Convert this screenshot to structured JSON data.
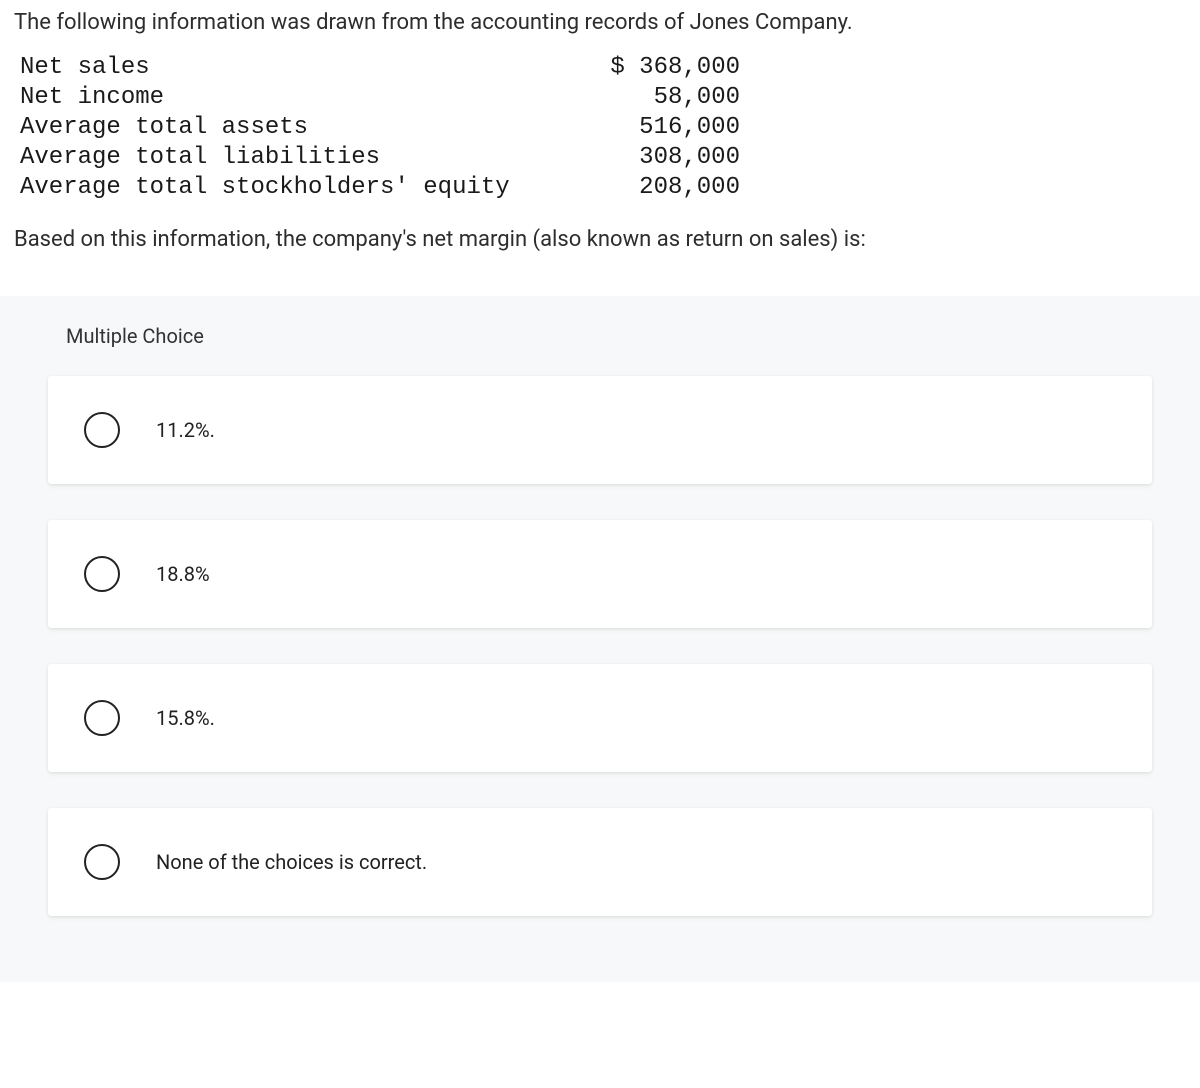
{
  "question": {
    "intro": "The following information was drawn from the accounting records of Jones Company.",
    "followup": "Based on this information, the company's net margin (also known as return on sales) is:"
  },
  "data_rows": [
    {
      "label": "Net sales",
      "value": "$ 368,000"
    },
    {
      "label": "Net income",
      "value": "58,000"
    },
    {
      "label": "Average total assets",
      "value": "516,000"
    },
    {
      "label": "Average total liabilities",
      "value": "308,000"
    },
    {
      "label": "Average total stockholders' equity",
      "value": "208,000"
    }
  ],
  "mc": {
    "heading": "Multiple Choice",
    "choices": [
      {
        "label": "11.2%."
      },
      {
        "label": "18.8%"
      },
      {
        "label": "15.8%."
      },
      {
        "label": "None of the choices is correct."
      }
    ]
  }
}
